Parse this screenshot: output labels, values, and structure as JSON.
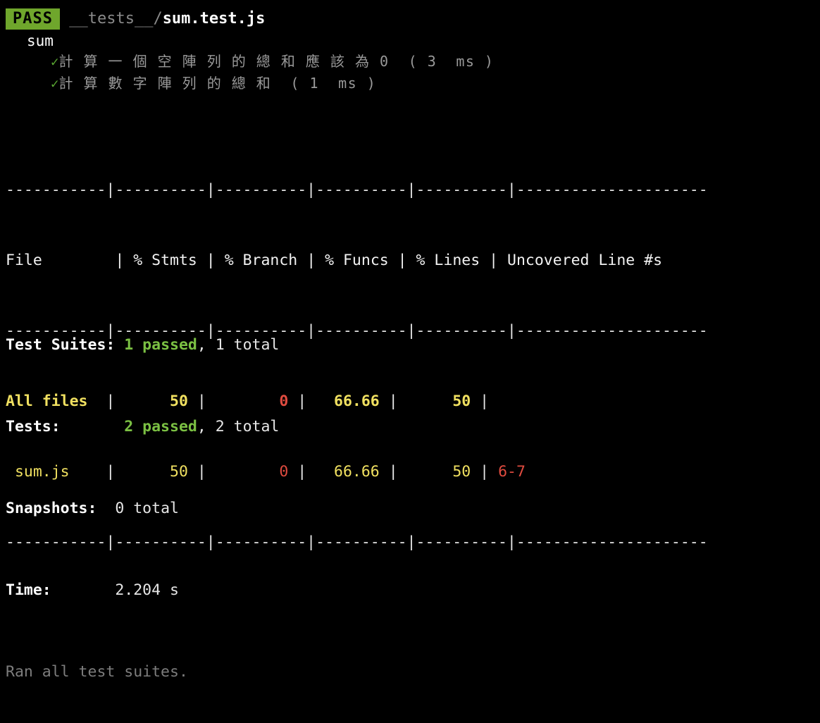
{
  "header": {
    "status_badge": "PASS",
    "path_prefix": "__tests__/",
    "path_file": "sum.test.js",
    "suite_name": "sum",
    "tests": [
      {
        "check": "✓",
        "text": "計 算 一 個 空 陣 列 的 總 和 應 該 為 0  ( 3  ms )"
      },
      {
        "check": "✓",
        "text": "計 算 數 字 陣 列 的 總 和  ( 1  ms )"
      }
    ]
  },
  "coverage": {
    "separator_top": "-----------|----------|----------|----------|----------|---------------------",
    "separator_mid": "-----------|----------|----------|----------|----------|---------------------",
    "separator_bot": "-----------|----------|----------|----------|----------|---------------------",
    "columns": [
      "File",
      "% Stmts",
      "% Branch",
      "% Funcs",
      "% Lines",
      "Uncovered Line #s"
    ],
    "header_row": "File        | % Stmts | % Branch | % Funcs | % Lines | Uncovered Line #s",
    "rows": [
      {
        "file": "All files",
        "bold": true,
        "stmts": "50",
        "branch": "0",
        "funcs": "66.66",
        "lines": "50",
        "uncovered": ""
      },
      {
        "file": " sum.js",
        "bold": false,
        "stmts": "50",
        "branch": "0",
        "funcs": "66.66",
        "lines": "50",
        "uncovered": "6-7"
      }
    ]
  },
  "summary": {
    "test_suites_label": "Test Suites:",
    "test_suites_passed": "1 passed",
    "test_suites_total": ", 1 total",
    "tests_label": "Tests:",
    "tests_passed": "2 passed",
    "tests_total": ", 2 total",
    "snapshots_label": "Snapshots:",
    "snapshots_value": "0 total",
    "time_label": "Time:",
    "time_value": "2.204 s",
    "footer": "Ran all test suites."
  },
  "colors": {
    "background": "#000000",
    "pass_badge_bg": "#6fa62c",
    "pass_badge_fg": "#000000",
    "yellow": "#f0e060",
    "red": "#e04b3f",
    "green": "#7bc043",
    "dim": "#8a8a8a"
  }
}
